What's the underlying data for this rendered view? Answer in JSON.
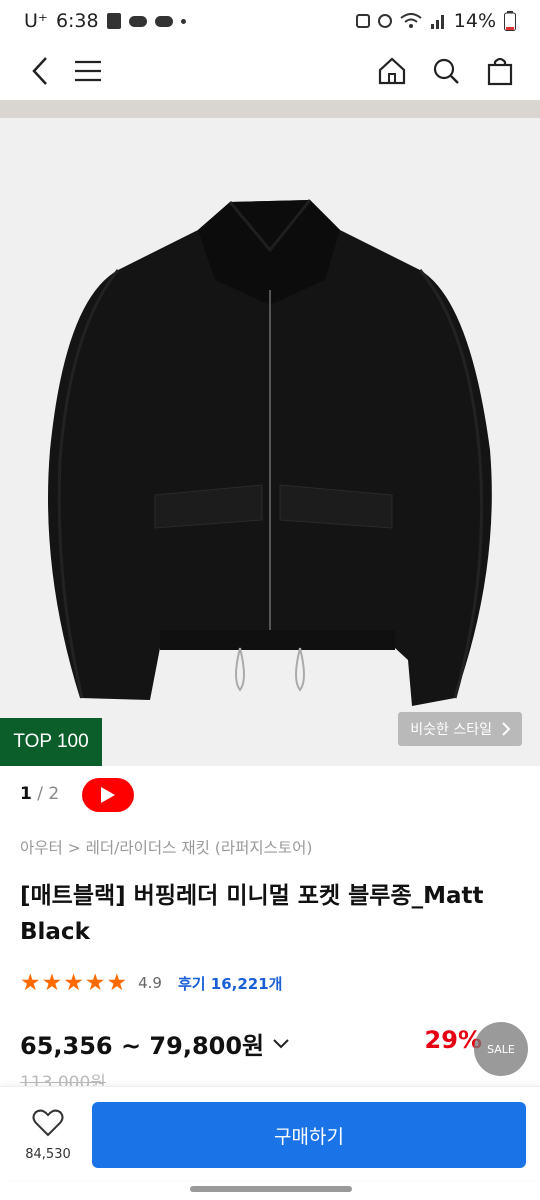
{
  "status_bar": {
    "carrier": "U⁺",
    "time": "6:38",
    "battery": "14%"
  },
  "nav": {
    "icons": [
      "back-icon",
      "menu-icon",
      "home-icon",
      "search-icon",
      "bag-icon"
    ]
  },
  "hero": {
    "similar_label": "비슷한 스타일",
    "badge": "TOP 100"
  },
  "pager": {
    "current": "1",
    "total": "2"
  },
  "product": {
    "breadcrumb": "아우터 > 레더/라이더스 재킷 (라퍼지스토어)",
    "title": "[매트블랙] 버핑레더 미니멀 포켓 블루종_Matt Black",
    "stars": "★★★★★",
    "rating": "4.9",
    "reviews": "후기 16,221개",
    "price": "65,356 ~ 79,800원",
    "discount": "29%",
    "original_price": "113,000원",
    "sale_label": "SALE"
  },
  "bottom": {
    "likes": "84,530",
    "buy_label": "구매하기"
  }
}
